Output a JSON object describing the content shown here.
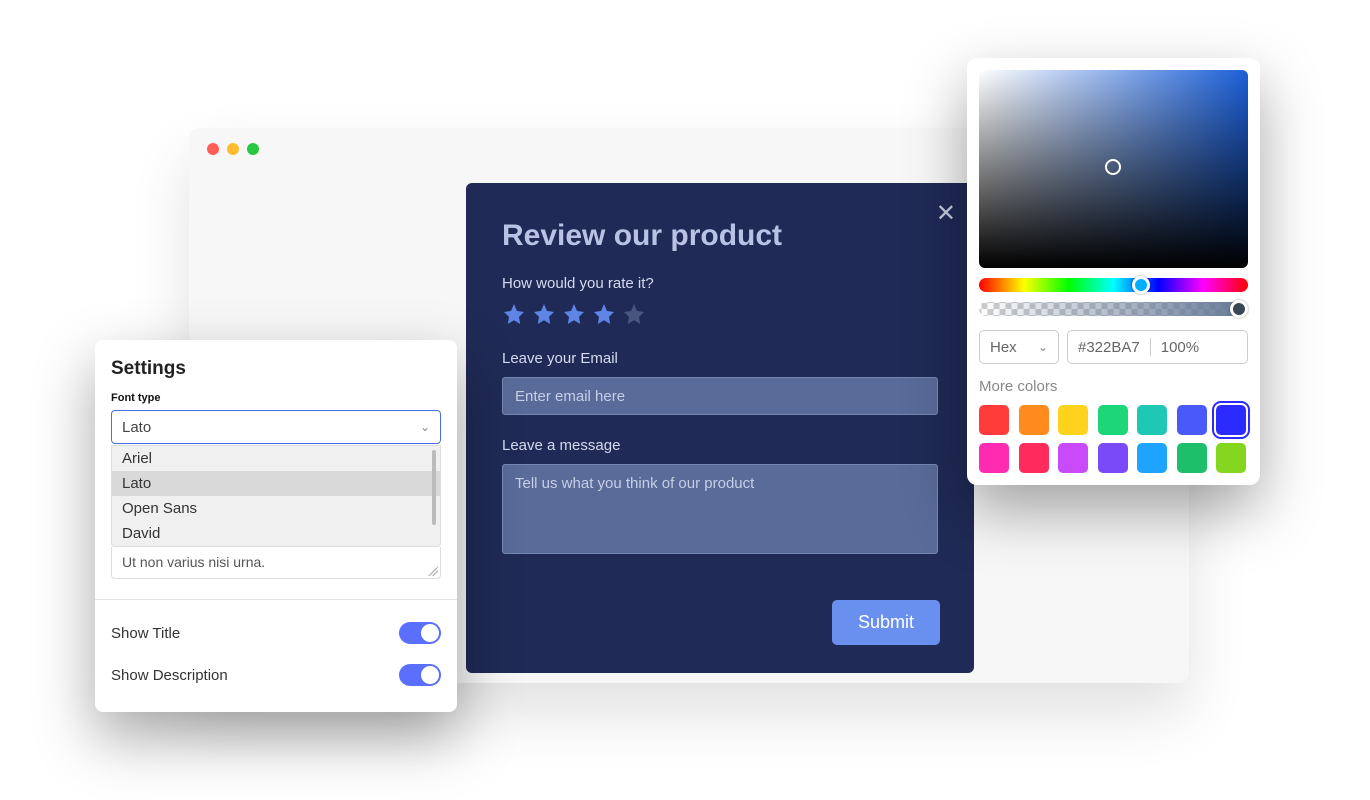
{
  "browser": {
    "dots": [
      "#ff5f57",
      "#febc2e",
      "#28c840"
    ]
  },
  "settings": {
    "title": "Settings",
    "fontTypeLabel": "Font type",
    "selectedFont": "Lato",
    "fontOptions": [
      "Ariel",
      "Lato",
      "Open Sans",
      "David"
    ],
    "lorem": "Ut non varius nisi urna.",
    "showTitleLabel": "Show Title",
    "showTitleOn": true,
    "showDescriptionLabel": "Show Description",
    "showDescriptionOn": true
  },
  "review": {
    "title": "Review our product",
    "rateLabel": "How would you rate it?",
    "rating": 4,
    "emailLabel": "Leave your Email",
    "emailPlaceholder": "Enter email here",
    "messageLabel": "Leave a message",
    "messagePlaceholder": "Tell us what you think of our product",
    "submitLabel": "Submit"
  },
  "picker": {
    "modeLabel": "Hex",
    "hexValue": "#322BA7",
    "alphaValue": "100%",
    "moreLabel": "More colors",
    "swatches": [
      "#ff3b3b",
      "#ff8a1e",
      "#ffd21e",
      "#1ed67a",
      "#1ec8b4",
      "#4a5af8",
      "#2b2bff",
      "#ff2bb0",
      "#ff2b5c",
      "#c94af8",
      "#7a4af8",
      "#1ea3ff",
      "#1ebf6a",
      "#84d61e"
    ],
    "selectedSwatchIndex": 6
  }
}
